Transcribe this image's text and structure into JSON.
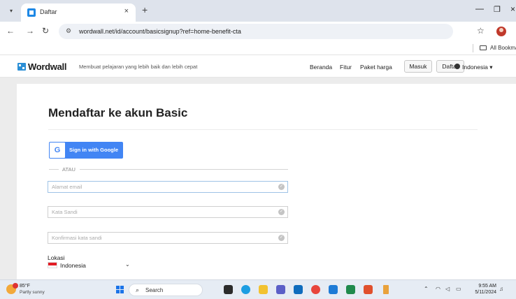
{
  "browser": {
    "tab_title": "Daftar",
    "url": "wordwall.net/id/account/basicsignup?ref=home-benefit-cta",
    "bookmarks_label": "All Bookmarks"
  },
  "site": {
    "logo": "Wordwall",
    "tagline": "Membuat pelajaran yang lebih baik dan lebih cepat",
    "nav": {
      "home": "Beranda",
      "features": "Fitur",
      "pricing": "Paket harga"
    },
    "login_label": "Masuk",
    "signup_label": "Daftar",
    "language": "Indonesia"
  },
  "form": {
    "title": "Mendaftar ke akun Basic",
    "google_label": "Sign in with Google",
    "or_label": "ATAU",
    "email": {
      "value": "",
      "placeholder": "Alamat email"
    },
    "password": {
      "value": "",
      "placeholder": "Kata Sandi"
    },
    "confirm": {
      "value": "",
      "placeholder": "Konfirmasi kata sandi"
    },
    "location_label": "Lokasi",
    "location_value": "Indonesia"
  },
  "taskbar": {
    "temperature": "85°F",
    "condition": "Partly sunny",
    "search_label": "Search",
    "time": "9:55 AM",
    "date": "5/11/2024"
  },
  "icons": {
    "chrome_menu": "chevron-down-icon",
    "tab_favicon": "wordwall-favicon-icon",
    "back": "back-arrow-icon",
    "forward": "forward-arrow-icon",
    "reload": "reload-icon",
    "site_info": "tune-icon",
    "bookmark_star": "star-icon",
    "folder": "folder-icon",
    "globe": "globe-icon",
    "field_check": "check-circle-icon",
    "weather": "weather-icon"
  },
  "colors": {
    "google_blue": "#4285f4",
    "wordwall_blue": "#2b8fd6",
    "flag_red": "#e21c24",
    "focus_border": "#9ec3e6"
  }
}
